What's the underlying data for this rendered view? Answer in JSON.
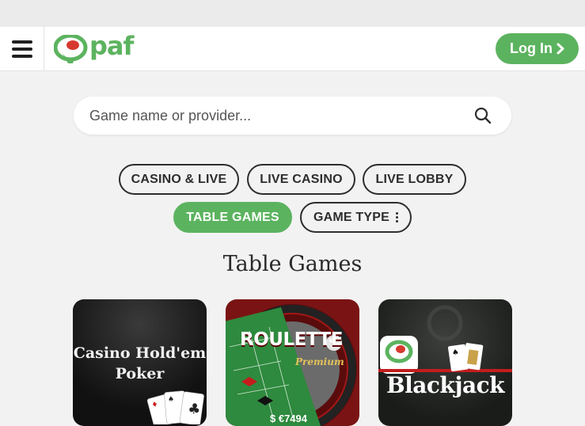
{
  "header": {
    "logo_text": "paf",
    "login_label": "Log In"
  },
  "search": {
    "placeholder": "Game name or provider..."
  },
  "filters": [
    {
      "label": "CASINO & LIVE",
      "active": false
    },
    {
      "label": "LIVE CASINO",
      "active": false
    },
    {
      "label": "LIVE LOBBY",
      "active": false
    },
    {
      "label": "TABLE GAMES",
      "active": true
    },
    {
      "label": "GAME TYPE",
      "active": false
    }
  ],
  "section": {
    "title": "Table Games"
  },
  "games": [
    {
      "title_line1": "Casino Hold'em",
      "title_line2": "Poker"
    },
    {
      "title": "ROULETTE",
      "subtitle": "Premium",
      "jackpot": "$ €7494"
    },
    {
      "title": "Blackjack"
    }
  ],
  "colors": {
    "brand_green": "#5cb35f",
    "background": "#f2f2f2",
    "text_dark": "#2d2d2d"
  }
}
